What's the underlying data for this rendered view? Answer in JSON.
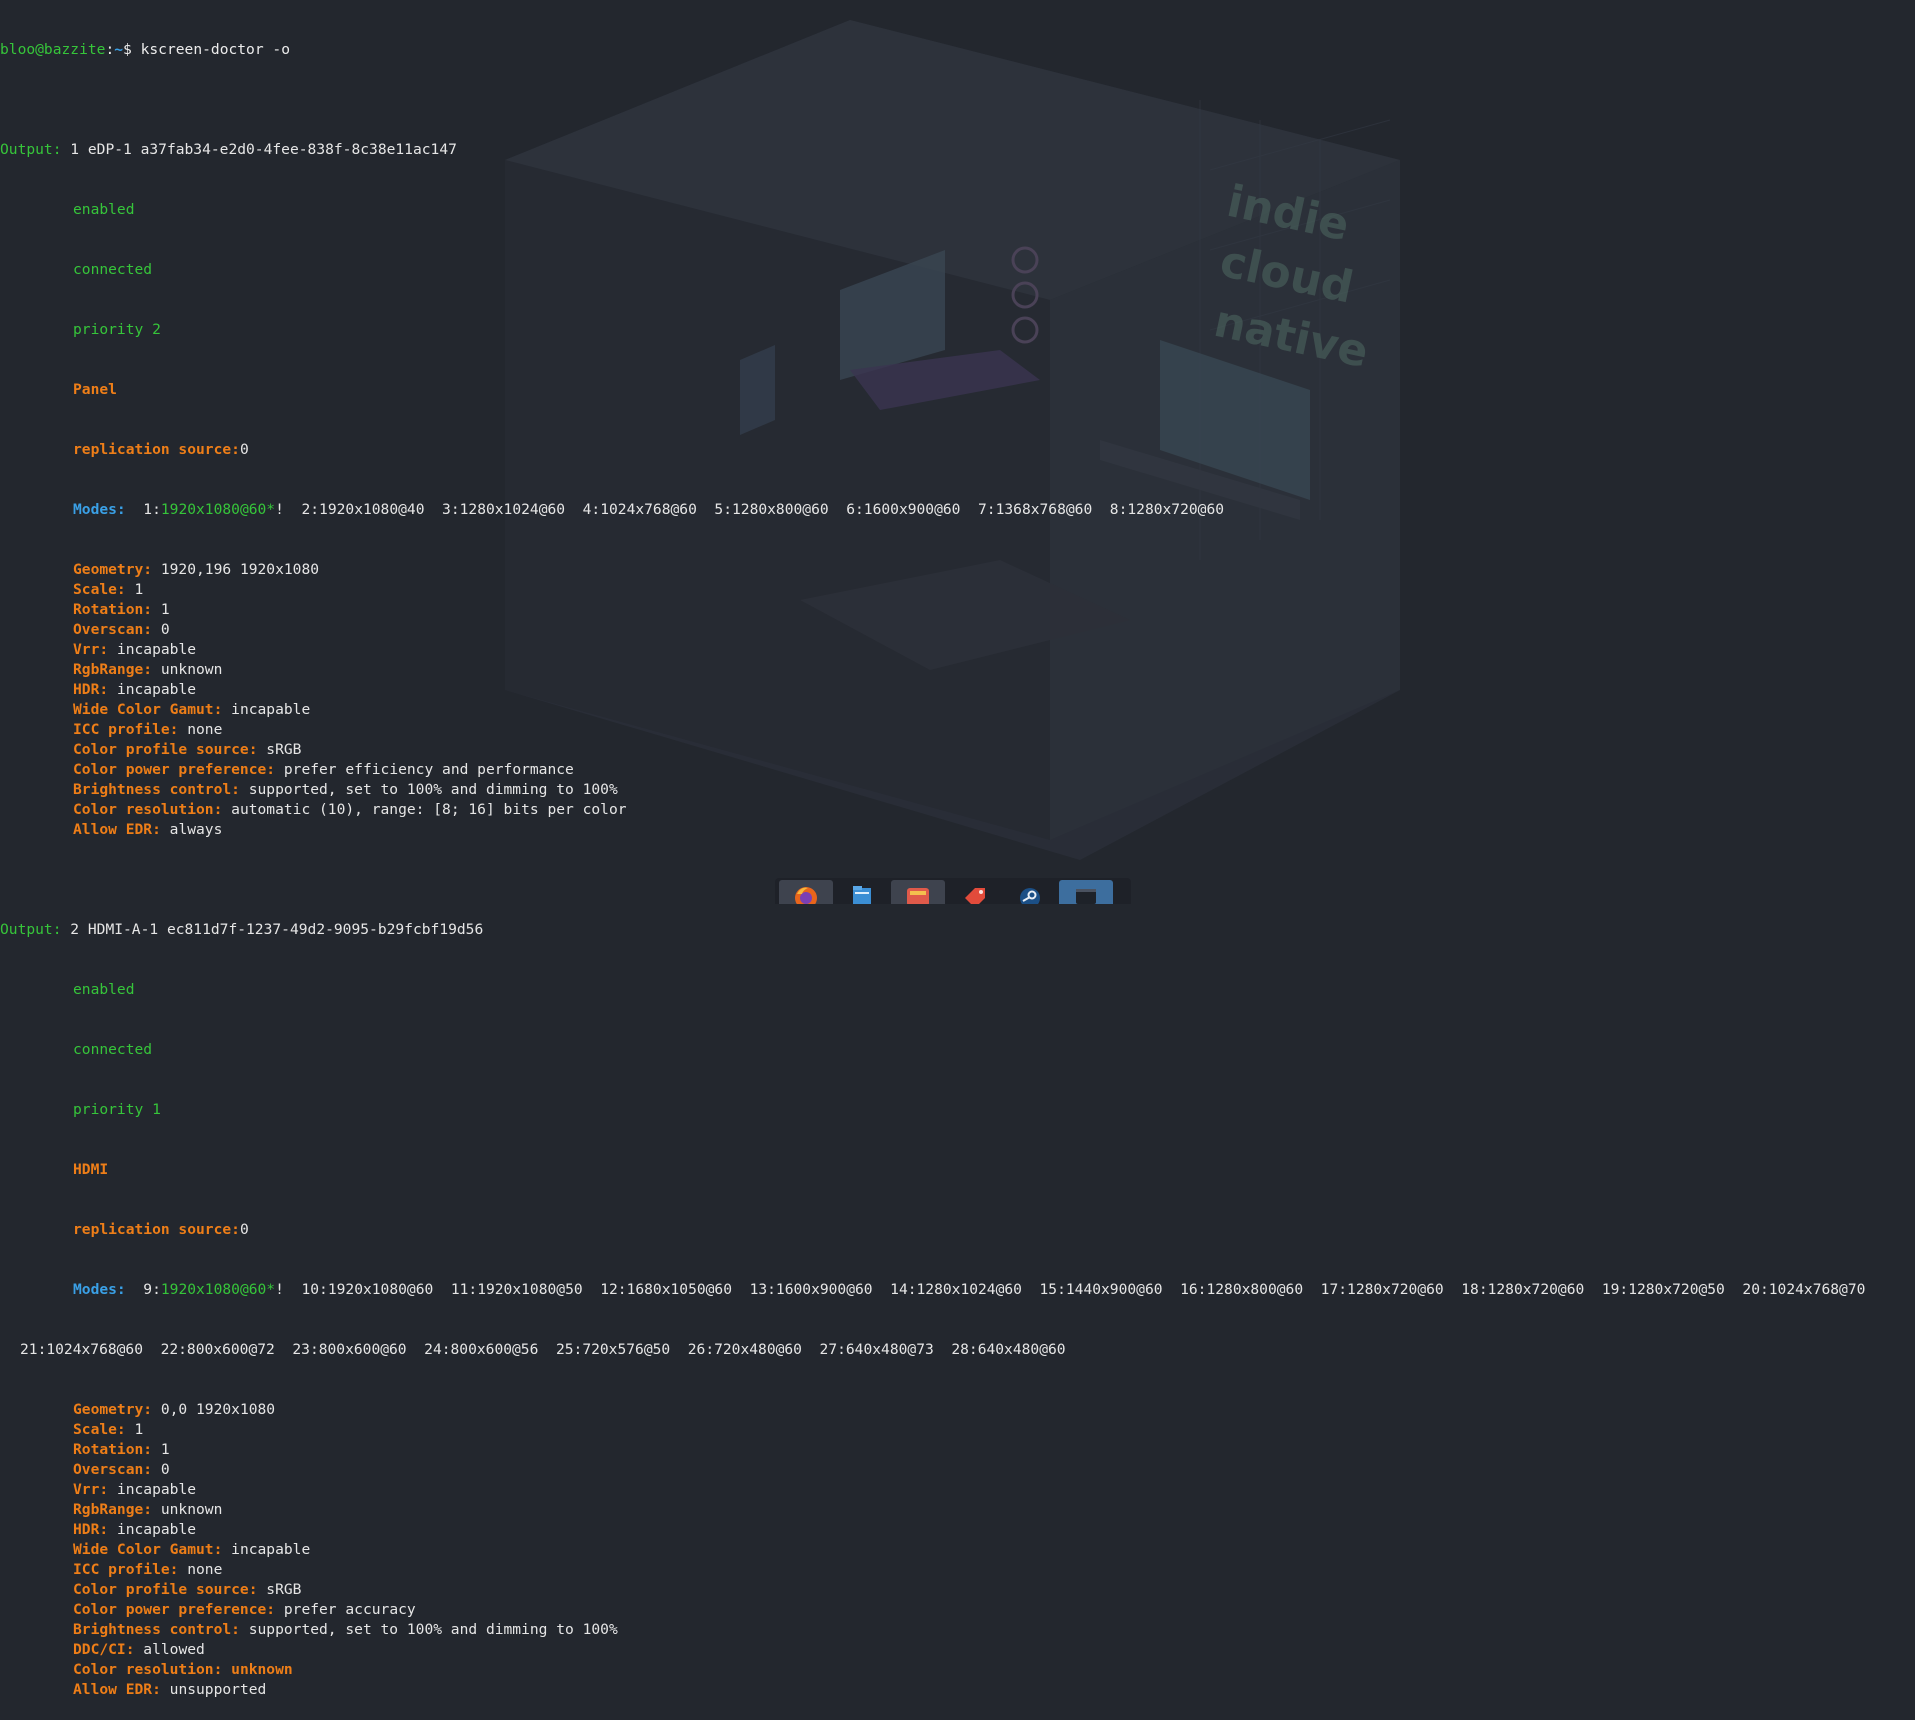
{
  "prompt": {
    "user_host": "bloo@bazzite",
    "separator": ":",
    "path": "~",
    "symbol": "$",
    "command": " kscreen-doctor -o"
  },
  "outputs": [
    {
      "header_label": "Output:",
      "header_value": " 1 eDP-1 a37fab34-e2d0-4fee-838f-8c38e11ac147",
      "enabled": "enabled",
      "connected": "connected",
      "priority": "priority 2",
      "type": "Panel",
      "replication_label": "replication source:",
      "replication_value": "0",
      "modes_label": "Modes:",
      "modes_current_prefix": "  1:",
      "modes_current": "1920x1080@60*",
      "modes_current_suffix": "!",
      "modes_rest": "  2:1920x1080@40  3:1280x1024@60  4:1024x768@60  5:1280x800@60  6:1600x900@60  7:1368x768@60  8:1280x720@60",
      "modes_wrap": "",
      "props": [
        {
          "k": "Geometry:",
          "v": " 1920,196 1920x1080"
        },
        {
          "k": "Scale:",
          "v": " 1"
        },
        {
          "k": "Rotation:",
          "v": " 1"
        },
        {
          "k": "Overscan:",
          "v": " 0"
        },
        {
          "k": "Vrr:",
          "v": " incapable"
        },
        {
          "k": "RgbRange:",
          "v": " unknown"
        },
        {
          "k": "HDR:",
          "v": " incapable"
        },
        {
          "k": "Wide Color Gamut:",
          "v": " incapable"
        },
        {
          "k": "ICC profile:",
          "v": " none"
        },
        {
          "k": "Color profile source:",
          "v": " sRGB"
        },
        {
          "k": "Color power preference:",
          "v": " prefer efficiency and performance"
        },
        {
          "k": "Brightness control:",
          "v": " supported, set to 100% and dimming to 100%"
        },
        {
          "k": "Color resolution:",
          "v": " automatic (10), range: [8; 16] bits per color"
        },
        {
          "k": "Allow EDR:",
          "v": " always"
        }
      ]
    },
    {
      "header_label": "Output:",
      "header_value": " 2 HDMI-A-1 ec811d7f-1237-49d2-9095-b29fcbf19d56",
      "enabled": "enabled",
      "connected": "connected",
      "priority": "priority 1",
      "type": "HDMI",
      "replication_label": "replication source:",
      "replication_value": "0",
      "modes_label": "Modes:",
      "modes_current_prefix": "  9:",
      "modes_current": "1920x1080@60*",
      "modes_current_suffix": "!",
      "modes_rest": "  10:1920x1080@60  11:1920x1080@50  12:1680x1050@60  13:1600x900@60  14:1280x1024@60  15:1440x900@60  16:1280x800@60  17:1280x720@60  18:1280x720@60  19:1280x720@50  20:1024x768@70",
      "modes_wrap": "21:1024x768@60  22:800x600@72  23:800x600@60  24:800x600@56  25:720x576@50  26:720x480@60  27:640x480@73  28:640x480@60",
      "props": [
        {
          "k": "Geometry:",
          "v": " 0,0 1920x1080"
        },
        {
          "k": "Scale:",
          "v": " 1"
        },
        {
          "k": "Rotation:",
          "v": " 1"
        },
        {
          "k": "Overscan:",
          "v": " 0"
        },
        {
          "k": "Vrr:",
          "v": " incapable"
        },
        {
          "k": "RgbRange:",
          "v": " unknown"
        },
        {
          "k": "HDR:",
          "v": " incapable"
        },
        {
          "k": "Wide Color Gamut:",
          "v": " incapable"
        },
        {
          "k": "ICC profile:",
          "v": " none"
        },
        {
          "k": "Color profile source:",
          "v": " sRGB"
        },
        {
          "k": "Color power preference:",
          "v": " prefer accuracy"
        },
        {
          "k": "Brightness control:",
          "v": " supported, set to 100% and dimming to 100%"
        },
        {
          "k": "DDC/CI:",
          "v": " allowed"
        },
        {
          "k": "Color resolution:",
          "v": " unknown"
        },
        {
          "k": "Allow EDR:",
          "v": " unsupported"
        }
      ]
    }
  ],
  "dock": {
    "items": [
      {
        "name": "firefox-icon",
        "state": "active"
      },
      {
        "name": "file-manager-icon",
        "state": "normal"
      },
      {
        "name": "app-store-icon",
        "state": "active"
      },
      {
        "name": "tag-app-icon",
        "state": "normal"
      },
      {
        "name": "steam-icon",
        "state": "normal"
      },
      {
        "name": "terminal-icon",
        "state": "current"
      }
    ]
  },
  "wallpaper": {
    "neon_sign": [
      "indie",
      "cloud",
      "native"
    ]
  },
  "colors": {
    "background": "#23272e",
    "green": "#36c53a",
    "orange": "#ee7e18",
    "blue": "#3aa0e6",
    "text": "#e6e6e6"
  }
}
